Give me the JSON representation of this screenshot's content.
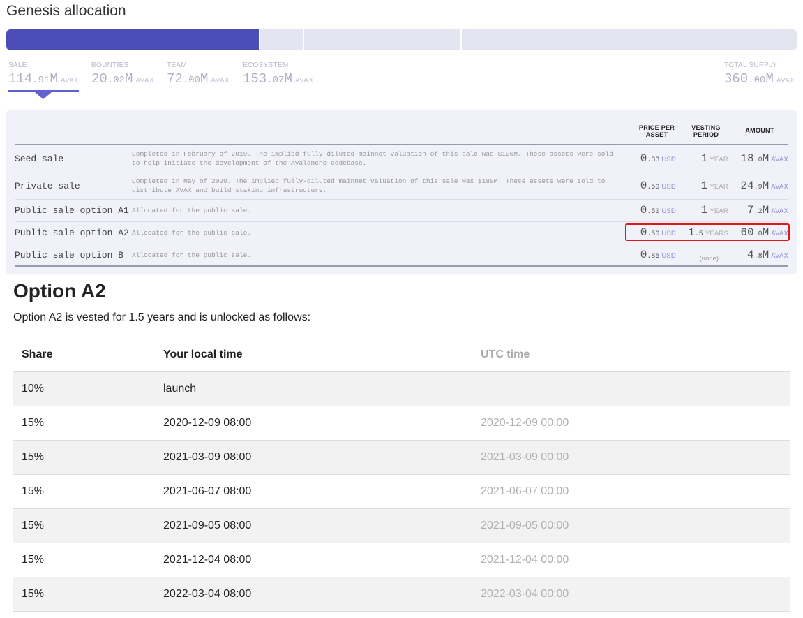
{
  "header": {
    "title": "Genesis allocation"
  },
  "allocation_bar": {
    "total": 360.0,
    "segments": [
      {
        "name": "sale",
        "value": 114.91,
        "active": true
      },
      {
        "name": "bounties",
        "value": 20.02,
        "active": false
      },
      {
        "name": "team",
        "value": 72.0,
        "active": false
      },
      {
        "name": "ecosystem",
        "value": 153.07,
        "active": false
      }
    ],
    "active_color": "#4d4db8",
    "inactive_color": "#e5e5f1"
  },
  "tabs": [
    {
      "label": "SALE",
      "int": "114",
      "dec": ".91",
      "suffix": "M",
      "unit": "AVAX",
      "active": true
    },
    {
      "label": "BOUNTIES",
      "int": "20",
      "dec": ".02",
      "suffix": "M",
      "unit": "AVAX",
      "active": false
    },
    {
      "label": "TEAM",
      "int": "72",
      "dec": ".00",
      "suffix": "M",
      "unit": "AVAX",
      "active": false
    },
    {
      "label": "ECOSYSTEM",
      "int": "153",
      "dec": ".07",
      "suffix": "M",
      "unit": "AVAX",
      "active": false
    },
    {
      "label": "TOTAL SUPPLY",
      "int": "360",
      "dec": ".00",
      "suffix": "M",
      "unit": "AVAX",
      "active": false
    }
  ],
  "sale_table": {
    "headers": {
      "price_1": "PRICE PER",
      "price_2": "ASSET",
      "vesting_1": "VESTING",
      "vesting_2": "PERIOD",
      "amount": "AMOUNT"
    },
    "rows": [
      {
        "name": "Seed sale",
        "description": "Completed in February of 2019. The implied fully-diluted mainnet valuation of this sale was $120M. These assets were sold to help initiate the development of the Avalanche codebase.",
        "price_int": "0",
        "price_dec": ".33",
        "price_unit": "USD",
        "vest_int": "1",
        "vest_dec": "",
        "vest_unit": "YEAR",
        "amount_int": "18",
        "amount_dec": ".0",
        "amount_suffix": "M",
        "amount_unit": "AVAX"
      },
      {
        "name": "Private sale",
        "description": "Completed in May of 2020. The implied fully-diluted mainnet valuation of this sale was $180M. These assets were sold to distribute AVAX and build staking infrastructure.",
        "price_int": "0",
        "price_dec": ".50",
        "price_unit": "USD",
        "vest_int": "1",
        "vest_dec": "",
        "vest_unit": "YEAR",
        "amount_int": "24",
        "amount_dec": ".9",
        "amount_suffix": "M",
        "amount_unit": "AVAX"
      },
      {
        "name": "Public sale option A1",
        "description": "Allocated for the public sale.",
        "price_int": "0",
        "price_dec": ".50",
        "price_unit": "USD",
        "vest_int": "1",
        "vest_dec": "",
        "vest_unit": "YEAR",
        "amount_int": "7",
        "amount_dec": ".2",
        "amount_suffix": "M",
        "amount_unit": "AVAX"
      },
      {
        "name": "Public sale option A2",
        "description": "Allocated for the public sale.",
        "price_int": "0",
        "price_dec": ".50",
        "price_unit": "USD",
        "vest_int": "1",
        "vest_dec": ".5",
        "vest_unit": "YEARS",
        "amount_int": "60",
        "amount_dec": ".0",
        "amount_suffix": "M",
        "amount_unit": "AVAX"
      },
      {
        "name": "Public sale option B",
        "description": "Allocated for the public sale.",
        "price_int": "0",
        "price_dec": ".85",
        "price_unit": "USD",
        "vest_none": "(none)",
        "amount_int": "4",
        "amount_dec": ".8",
        "amount_suffix": "M",
        "amount_unit": "AVAX"
      }
    ]
  },
  "option": {
    "title": "Option A2",
    "description": "Option A2 is vested for 1.5 years and is unlocked as follows:",
    "table": {
      "headers": {
        "share": "Share",
        "local": "Your local time",
        "utc": "UTC time"
      },
      "rows": [
        {
          "share": "10%",
          "local": "launch",
          "utc": ""
        },
        {
          "share": "15%",
          "local": "2020-12-09 08:00",
          "utc": "2020-12-09 00:00"
        },
        {
          "share": "15%",
          "local": "2021-03-09 08:00",
          "utc": "2021-03-09 00:00"
        },
        {
          "share": "15%",
          "local": "2021-06-07 08:00",
          "utc": "2021-06-07 00:00"
        },
        {
          "share": "15%",
          "local": "2021-09-05 08:00",
          "utc": "2021-09-05 00:00"
        },
        {
          "share": "15%",
          "local": "2021-12-04 08:00",
          "utc": "2021-12-04 00:00"
        },
        {
          "share": "15%",
          "local": "2022-03-04 08:00",
          "utc": "2022-03-04 00:00"
        }
      ]
    }
  }
}
